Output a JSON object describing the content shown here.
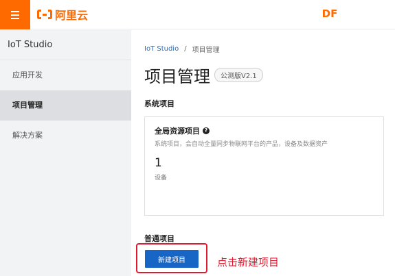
{
  "topbar": {
    "menu_icon": "hamburger-menu-icon",
    "logo_text": "阿里云",
    "center_text": "DF"
  },
  "sidebar": {
    "title": "IoT Studio",
    "items": [
      {
        "label": "应用开发",
        "active": false
      },
      {
        "label": "项目管理",
        "active": true
      },
      {
        "label": "解决方案",
        "active": false
      }
    ]
  },
  "main": {
    "breadcrumb": {
      "root": "IoT Studio",
      "separator": "/",
      "current": "项目管理"
    },
    "title": "项目管理",
    "version_badge": "公测版V2.1",
    "system_section_label": "系统项目",
    "card": {
      "title": "全局资源项目",
      "help_icon": "question-circle-icon",
      "description": "系统项目，会自动全量同步物联网平台的产品，设备及数据资产",
      "count": "1",
      "count_label": "设备"
    },
    "normal_section_label": "普通项目",
    "new_button_label": "新建项目",
    "annotation": "点击新建项目"
  },
  "colors": {
    "brand_orange": "#ff6a00",
    "primary_blue": "#1765c4",
    "annotation_red": "#e0192e"
  }
}
